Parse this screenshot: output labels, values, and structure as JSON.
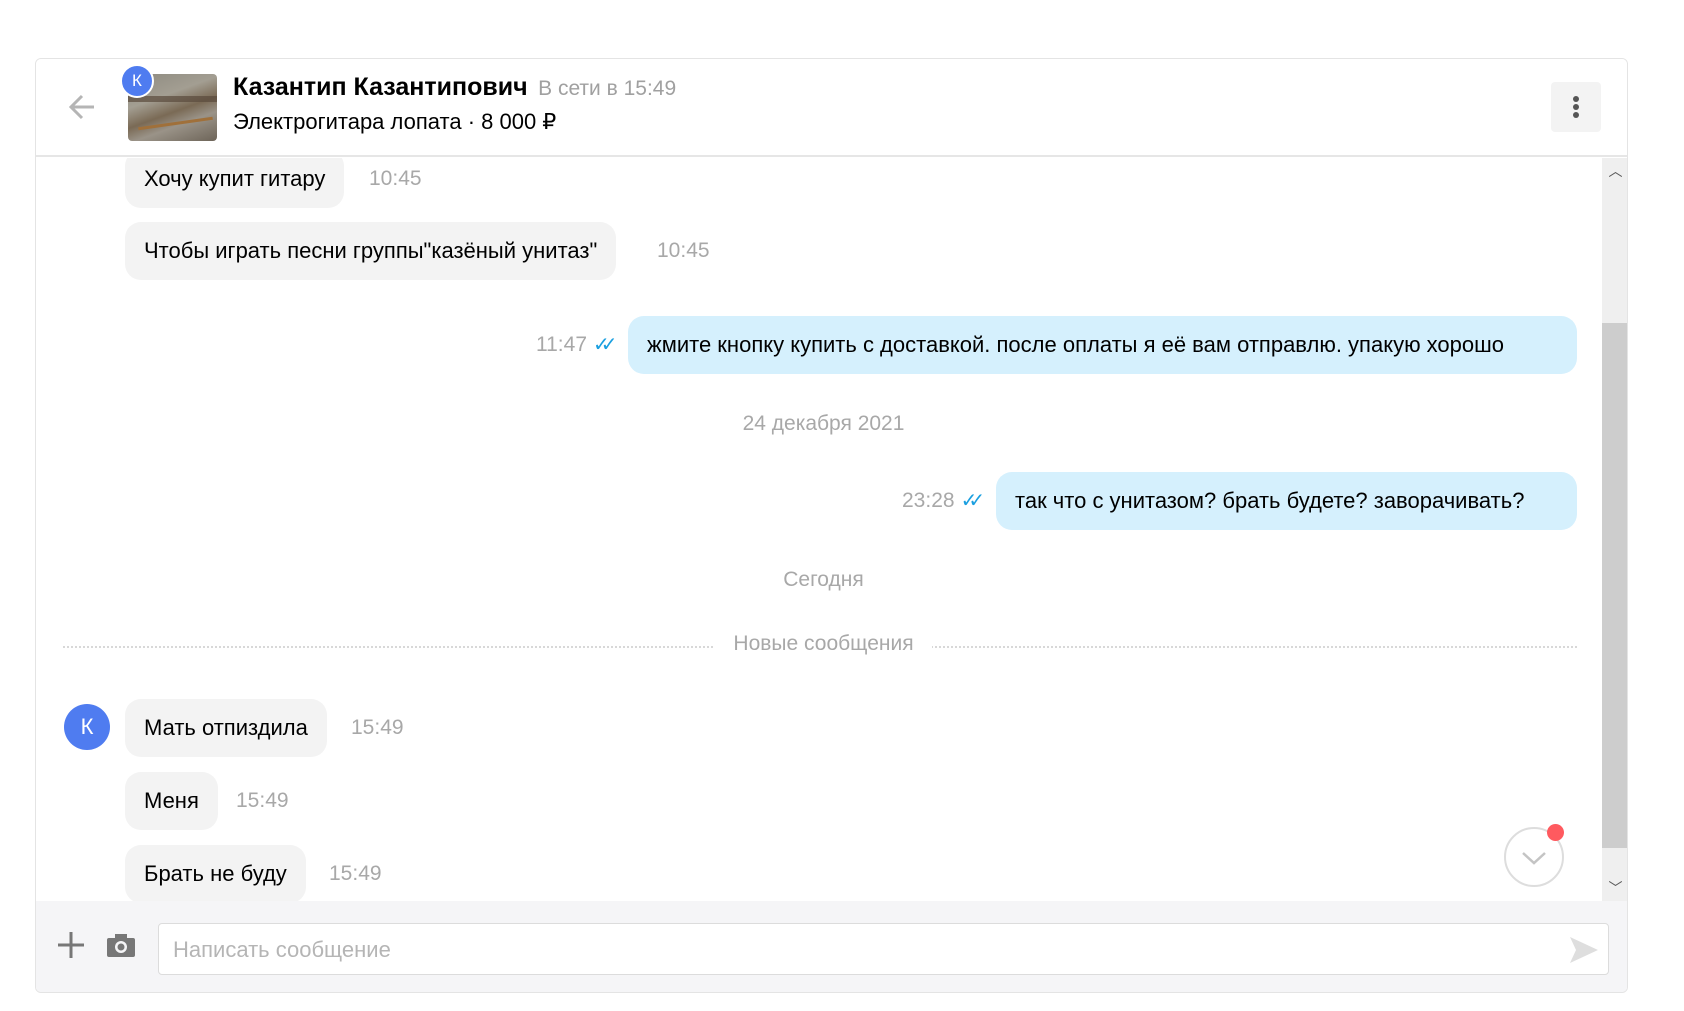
{
  "header": {
    "contact_name": "Казантип Казантипович",
    "status": "В сети в 15:49",
    "listing": "Электрогитара лопата · 8 000 ₽",
    "avatar_letter": "К"
  },
  "messages": [
    {
      "dir": "in",
      "text": "Хочу купит гитару",
      "time": "10:45"
    },
    {
      "dir": "in",
      "text": "Чтобы играть песни группы\"казёный унитаз\"",
      "time": "10:45"
    },
    {
      "dir": "out",
      "text": "жмите кнопку купить с доставкой. после оплаты я её вам отправлю. упакую хорошо",
      "time": "11:47"
    },
    {
      "dir": "out",
      "text": "так что с унитазом? брать будете? заворачивать?",
      "time": "23:28"
    },
    {
      "dir": "in",
      "text": "Мать отпиздила",
      "time": "15:49"
    },
    {
      "dir": "in",
      "text": "Меня",
      "time": "15:49"
    },
    {
      "dir": "in",
      "text": "Брать не буду",
      "time": "15:49"
    }
  ],
  "separators": {
    "date1": "24 декабря 2021",
    "today": "Сегодня",
    "new_messages": "Новые сообщения"
  },
  "composer": {
    "placeholder": "Написать сообщение"
  },
  "colors": {
    "accent": "#4f7cf0",
    "outgoing": "#d5f0fd",
    "check": "#1a9fe0",
    "badge": "#ff5a5f"
  }
}
